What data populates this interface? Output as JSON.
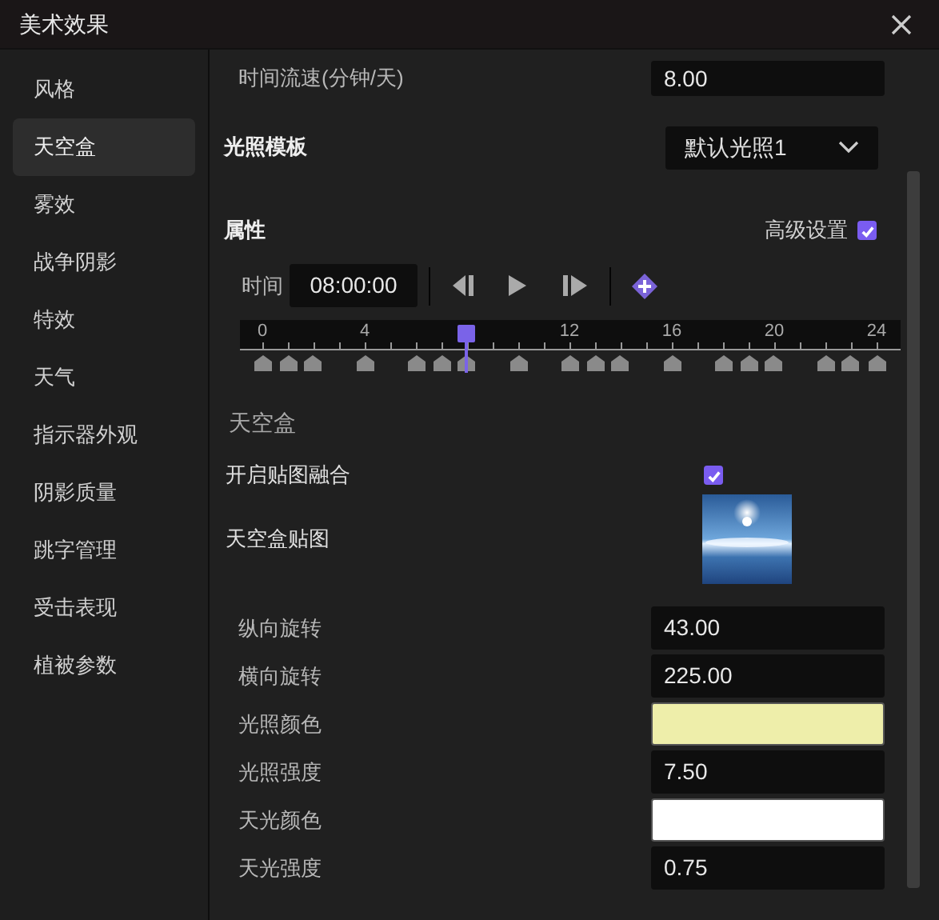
{
  "window": {
    "title": "美术效果"
  },
  "sidebar": {
    "items": [
      {
        "label": "风格",
        "selected": false
      },
      {
        "label": "天空盒",
        "selected": true
      },
      {
        "label": "雾效",
        "selected": false
      },
      {
        "label": "战争阴影",
        "selected": false
      },
      {
        "label": "特效",
        "selected": false
      },
      {
        "label": "天气",
        "selected": false
      },
      {
        "label": "指示器外观",
        "selected": false
      },
      {
        "label": "阴影质量",
        "selected": false
      },
      {
        "label": "跳字管理",
        "selected": false
      },
      {
        "label": "受击表现",
        "selected": false
      },
      {
        "label": "植被参数",
        "selected": false
      }
    ]
  },
  "time_speed": {
    "label": "时间流速(分钟/天)",
    "value": "8.00"
  },
  "light_template": {
    "label": "光照模板",
    "value": "默认光照1"
  },
  "properties": {
    "label": "属性",
    "advanced": {
      "label": "高级设置",
      "checked": true
    }
  },
  "time": {
    "label": "时间",
    "value": "08:00:00"
  },
  "timeline": {
    "tick_labels": [
      "0",
      "4",
      "12",
      "16",
      "20",
      "24"
    ],
    "playhead": {
      "level": 0.3333
    },
    "keyframes": [
      {
        "level": 0
      },
      {
        "level": 0.0417
      },
      {
        "level": 0.0833
      },
      {
        "level": 0.1667
      },
      {
        "level": 0.25
      },
      {
        "level": 0.2917
      },
      {
        "level": 0.3333
      },
      {
        "level": 0.4167
      },
      {
        "level": 0.5
      },
      {
        "level": 0.5417
      },
      {
        "level": 0.5833
      },
      {
        "level": 0.6667
      },
      {
        "level": 0.75
      },
      {
        "level": 0.7917
      },
      {
        "level": 0.8333
      },
      {
        "level": 0.9167
      },
      {
        "level": 0.9583
      },
      {
        "level": 1
      }
    ]
  },
  "skybox": {
    "heading": "天空盒",
    "blend": {
      "label": "开启贴图融合",
      "checked": true
    },
    "texture": {
      "label": "天空盒贴图",
      "kind": "picture"
    },
    "fields": [
      {
        "label": "纵向旋转",
        "kind": "number",
        "value": "43.00"
      },
      {
        "label": "横向旋转",
        "kind": "number",
        "value": "225.00"
      },
      {
        "label": "光照颜色",
        "kind": "color",
        "color": "#eeeeaa"
      },
      {
        "label": "光照强度",
        "kind": "number",
        "value": "7.50"
      },
      {
        "label": "天光颜色",
        "kind": "color",
        "color": "#ffffff"
      },
      {
        "label": "天光强度",
        "kind": "number",
        "value": "0.75"
      }
    ]
  }
}
